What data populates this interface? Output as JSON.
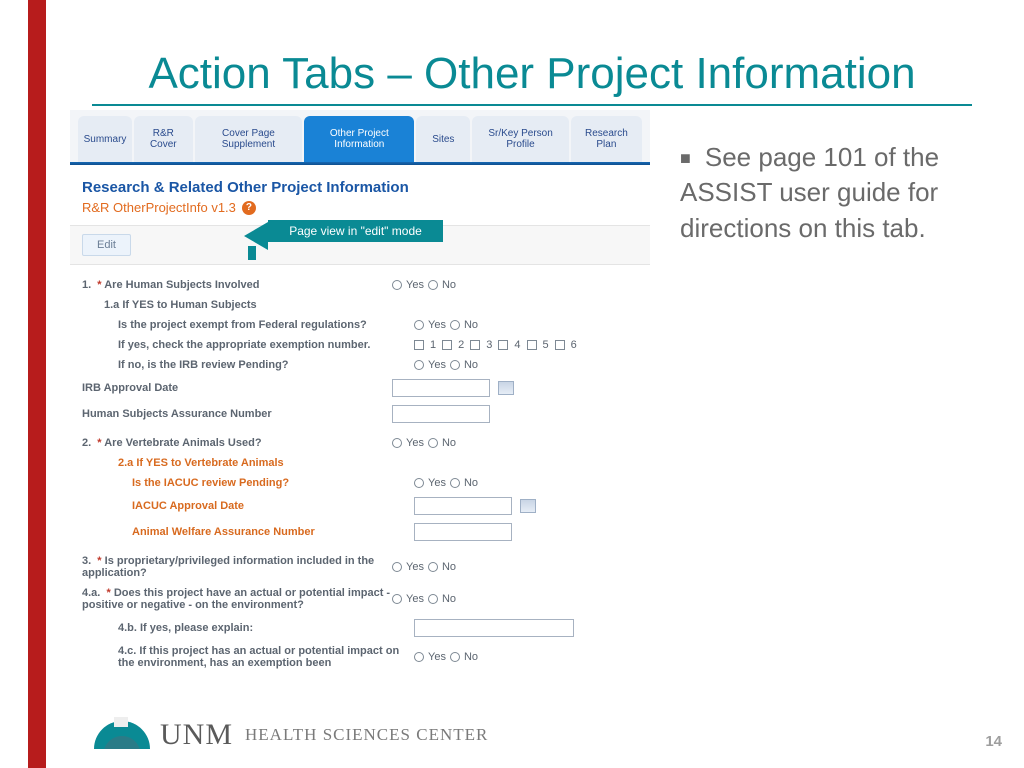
{
  "slide": {
    "title": "Action Tabs – Other Project Information",
    "bullet": "See page 101 of the ASSIST user guide for directions on this tab.",
    "page_number": "14"
  },
  "tabs": [
    "Summary",
    "R&R Cover",
    "Cover Page Supplement",
    "Other Project Information",
    "Sites",
    "Sr/Key Person Profile",
    "Research Plan"
  ],
  "section": {
    "heading": "Research & Related Other Project Information",
    "version": "R&R OtherProjectInfo v1.3"
  },
  "callout": "Page view in \"edit\" mode",
  "buttons": {
    "edit": "Edit"
  },
  "radio": {
    "yes": "Yes",
    "no": "No"
  },
  "checkbox_labels": [
    "1",
    "2",
    "3",
    "4",
    "5",
    "6"
  ],
  "q": {
    "q1": "Are Human Subjects Involved",
    "q1a": "1.a If YES to Human Subjects",
    "q1a_1": "Is the project exempt from Federal regulations?",
    "q1a_2": "If yes, check the appropriate exemption number.",
    "q1a_3": "If no, is the IRB review Pending?",
    "irb_date": "IRB Approval Date",
    "hsan": "Human Subjects Assurance Number",
    "q2": "Are Vertebrate Animals Used?",
    "q2a": "2.a If YES to Vertebrate Animals",
    "q2a_1": "Is the IACUC review Pending?",
    "q2a_2": "IACUC Approval Date",
    "q2a_3": "Animal Welfare Assurance Number",
    "q3": "Is proprietary/privileged information included in the application?",
    "q4a": "Does this project have an actual or potential impact - positive or negative - on the environment?",
    "q4b": "4.b. If yes, please explain:",
    "q4c": "4.c.  If this project has an actual or potential impact on the environment, has an exemption been"
  },
  "footer": {
    "brand1": "UNM",
    "brand2": "HEALTH SCIENCES CENTER"
  }
}
